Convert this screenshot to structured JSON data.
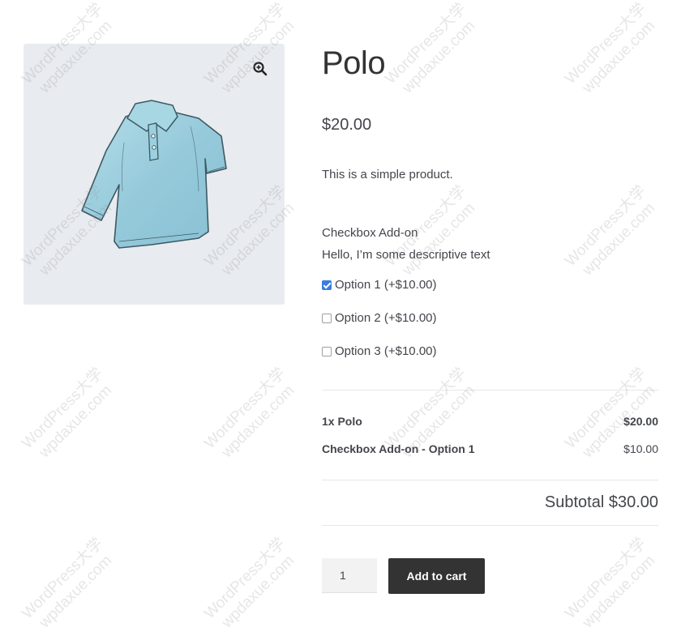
{
  "product": {
    "title": "Polo",
    "price": "$20.00",
    "description": "This is a simple product.",
    "image_icon": "polo-shirt-image",
    "zoom_icon": "magnifier-plus-icon"
  },
  "addon": {
    "title": "Checkbox Add-on",
    "description": "Hello, I’m some descriptive text",
    "options": [
      {
        "label": "Option 1 (+$10.00)",
        "checked": true
      },
      {
        "label": "Option 2 (+$10.00)",
        "checked": false
      },
      {
        "label": "Option 3 (+$10.00)",
        "checked": false
      }
    ]
  },
  "totals": {
    "lines": [
      {
        "label": "1x Polo",
        "amount": "$20.00"
      },
      {
        "label": "Checkbox Add-on - Option 1",
        "amount": "$10.00"
      }
    ],
    "subtotal": "Subtotal $30.00"
  },
  "cart": {
    "quantity": "1",
    "button_label": "Add to cart"
  },
  "watermark": {
    "line1": "WordPress大学",
    "line2": "wpdaxue.com"
  },
  "colors": {
    "checkbox_checked": "#3b7dde",
    "button_bg": "#333333",
    "image_bg": "#e8ebef",
    "shirt": "#9fd0df"
  }
}
